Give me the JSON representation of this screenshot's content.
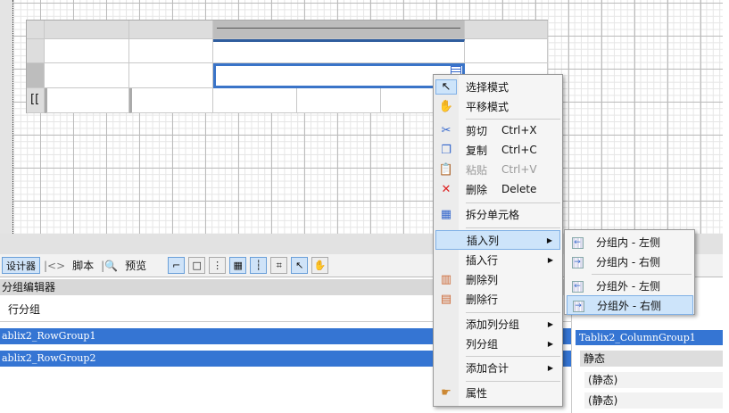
{
  "toolbar": {
    "designer": "设计器",
    "script": "脚本",
    "preview": "预览"
  },
  "group_editor": {
    "title": "分组编辑器",
    "row_groups_label": "行分组",
    "row_groups": [
      "ablix2_RowGroup1",
      "ablix2_RowGroup2"
    ],
    "column_groups": [
      "Tablix2_ColumnGroup1"
    ],
    "static_header": "静态",
    "static_items": [
      "(静态)",
      "(静态)"
    ]
  },
  "context_menu": {
    "items": [
      {
        "label": "选择模式",
        "icon": "pointer-icon"
      },
      {
        "label": "平移模式",
        "icon": "hand-icon"
      },
      {
        "label": "剪切",
        "shortcut": "Ctrl+X",
        "icon": "scissors-icon"
      },
      {
        "label": "复制",
        "shortcut": "Ctrl+C",
        "icon": "copy-icon"
      },
      {
        "label": "粘贴",
        "shortcut": "Ctrl+V",
        "icon": "paste-icon",
        "disabled": true
      },
      {
        "label": "删除",
        "shortcut": "Delete",
        "icon": "delete-icon"
      },
      {
        "label": "拆分单元格",
        "icon": "split-cell-icon"
      },
      {
        "label": "插入列",
        "submenu": true
      },
      {
        "label": "插入行",
        "submenu": true
      },
      {
        "label": "删除列",
        "icon": "delete-column-icon"
      },
      {
        "label": "删除行",
        "icon": "delete-row-icon"
      },
      {
        "label": "添加列分组",
        "submenu": true
      },
      {
        "label": "列分组",
        "submenu": true
      },
      {
        "label": "添加合计",
        "submenu": true
      },
      {
        "label": "属性",
        "icon": "properties-icon"
      }
    ]
  },
  "submenu": {
    "items": [
      "分组内 - 左侧",
      "分组内 - 右侧",
      "分组外 - 左侧",
      "分组外 - 右侧"
    ]
  },
  "colors": {
    "selection": "#3575d3",
    "highlight": "#cde4fa"
  }
}
